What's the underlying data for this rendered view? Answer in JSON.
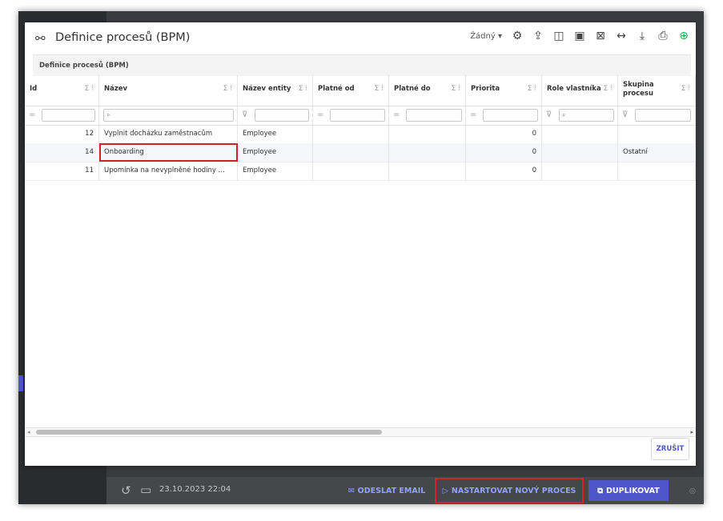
{
  "background": {
    "history_icon": "history-icon",
    "schedule_icon": "schedule-icon",
    "date": "23.10.2023 22:04",
    "send_email": "ODESLAT EMAIL",
    "start_process": "NASTARTOVAT NOVÝ PROCES",
    "duplicate": "DUPLIKOVAT"
  },
  "modal": {
    "title": "Definice procesů (BPM)",
    "section_title": "Definice procesů (BPM)",
    "toolbar": {
      "select_value": "Žádný"
    },
    "cancel_label": "ZRUŠIT"
  },
  "grid": {
    "columns": {
      "id": "Id",
      "name": "Název",
      "entity": "Název entity",
      "valid_from": "Platné od",
      "valid_to": "Platné do",
      "priority": "Priorita",
      "owner_role": "Role vlastníka",
      "group": "Skupina procesu"
    },
    "rows": [
      {
        "id": "12",
        "name": "Vyplnit docházku zaměstnacům",
        "entity": "Employee",
        "valid_from": "",
        "valid_to": "",
        "priority": "0",
        "owner_role": "",
        "group": ""
      },
      {
        "id": "14",
        "name": "Onboarding",
        "entity": "Employee",
        "valid_from": "",
        "valid_to": "",
        "priority": "0",
        "owner_role": "",
        "group": "Ostatní"
      },
      {
        "id": "11",
        "name": "Upomínka na nevyplněné hodiny ...",
        "entity": "Employee",
        "valid_from": "",
        "valid_to": "",
        "priority": "0",
        "owner_role": "",
        "group": ""
      }
    ]
  },
  "colors": {
    "accent": "#4f57c8",
    "highlight": "#d61f2c",
    "add": "#1fa84f"
  }
}
